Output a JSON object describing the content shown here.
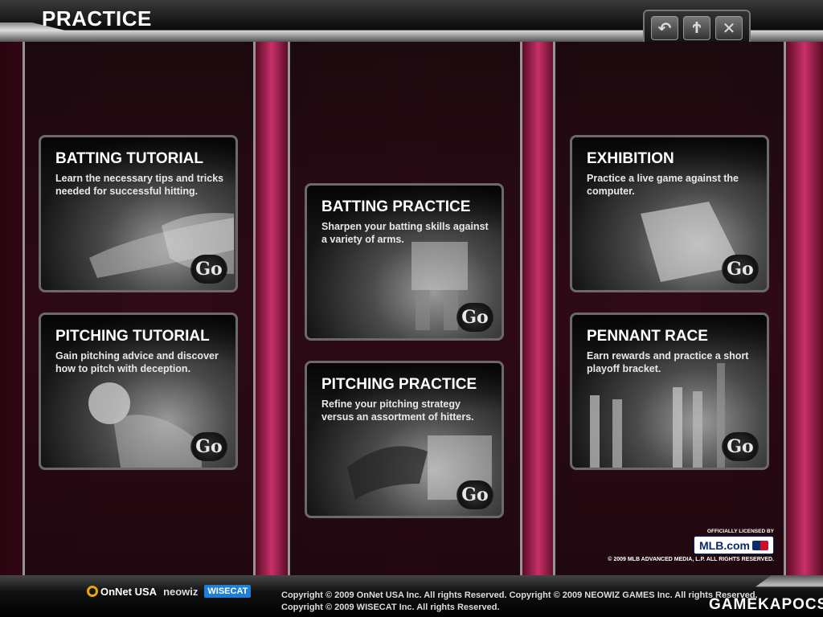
{
  "header": {
    "title": "PRACTICE",
    "buttons": [
      {
        "name": "back-button",
        "icon": "back-arrow-icon",
        "glyph": "↶"
      },
      {
        "name": "settings-button",
        "icon": "wrench-icon",
        "glyph": "Ϯ"
      },
      {
        "name": "close-button",
        "icon": "close-icon",
        "glyph": "✕"
      }
    ]
  },
  "cards": {
    "batting_tutorial": {
      "title": "BATTING TUTORIAL",
      "desc": "Learn the necessary tips and tricks needed for successful hitting.",
      "go": "Go"
    },
    "pitching_tutorial": {
      "title": "PITCHING TUTORIAL",
      "desc": "Gain pitching advice and discover how to pitch with deception.",
      "go": "Go"
    },
    "batting_practice": {
      "title": "BATTING PRACTICE",
      "desc": "Sharpen your batting skills against a variety of arms.",
      "go": "Go"
    },
    "pitching_practice": {
      "title": "PITCHING PRACTICE",
      "desc": "Refine your pitching strategy versus an assortment of hitters.",
      "go": "Go"
    },
    "exhibition": {
      "title": "EXHIBITION",
      "desc": "Practice a live game against the computer.",
      "go": "Go"
    },
    "pennant_race": {
      "title": "PENNANT RACE",
      "desc": "Earn rewards and practice a short playoff bracket.",
      "go": "Go"
    }
  },
  "mlb": {
    "licensed": "OFFICIALLY LICENSED BY",
    "logo": "MLB.com",
    "rights": "© 2009 MLB ADVANCED MEDIA, L.P. ALL RIGHTS RESERVED."
  },
  "footer": {
    "onnet": "OnNet USA",
    "neowiz": "neowiz",
    "wisecat": "WISECAT",
    "copyright_line1": "Copyright © 2009 OnNet USA Inc. All rights Reserved. Copyright © 2009 NEOWIZ GAMES Inc. All rights Reserved.",
    "copyright_line2": "Copyright © 2009 WISECAT Inc. All rights Reserved.",
    "watermark": "GAMEKAPOCS"
  }
}
